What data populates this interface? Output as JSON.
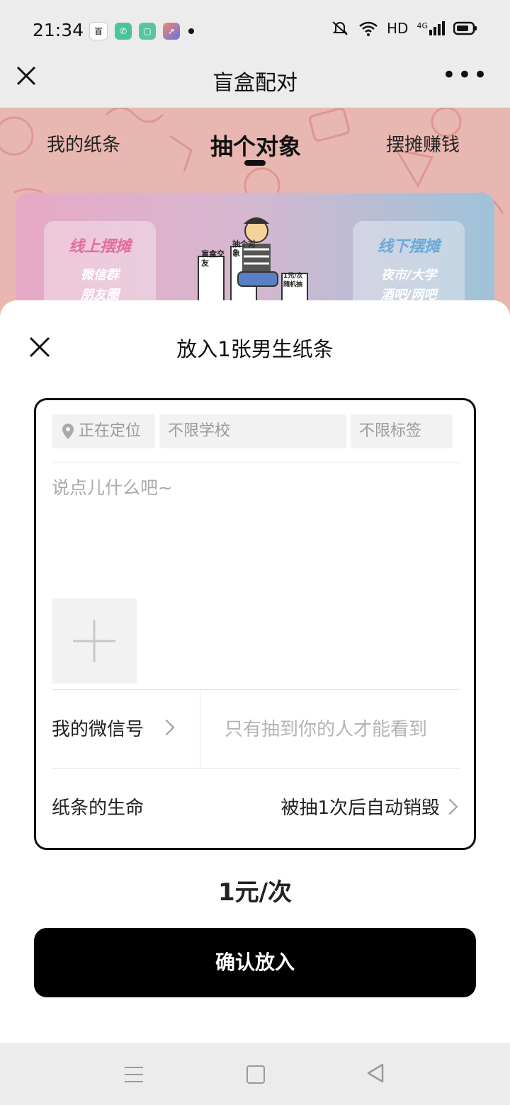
{
  "status_bar": {
    "time": "21:34",
    "network": "HD",
    "network_gen": "4G"
  },
  "app_bar": {
    "title": "盲盒配对"
  },
  "tabs": [
    {
      "label": "我的纸条",
      "active": false
    },
    {
      "label": "抽个对象",
      "active": true
    },
    {
      "label": "摆摊赚钱",
      "active": false
    }
  ],
  "banner": {
    "left_card": {
      "title": "线上摆摊",
      "line1": "微信群",
      "line2": "朋友圈"
    },
    "right_card": {
      "title": "线下摆摊",
      "line1": "夜市/大学",
      "line2": "酒吧/网吧"
    },
    "sign_left": "抽个对象",
    "sign_left2": "盲盒交友",
    "sign_right": "1元/次",
    "sign_right2": "随机抽"
  },
  "sheet": {
    "title": "放入1张男生纸条",
    "chips": {
      "location": "正在定位",
      "school": "不限学校",
      "tag": "不限标签"
    },
    "message_placeholder": "说点儿什么吧~",
    "wechat": {
      "label": "我的微信号",
      "placeholder": "只有抽到你的人才能看到"
    },
    "life": {
      "label": "纸条的生命",
      "value": "被抽1次后自动销毁"
    },
    "price": "1元/次",
    "confirm_label": "确认放入"
  },
  "colors": {
    "confirm_bg": "#000000",
    "placeholder": "#aaaaaa",
    "banner_accent": "#e26c9d"
  }
}
